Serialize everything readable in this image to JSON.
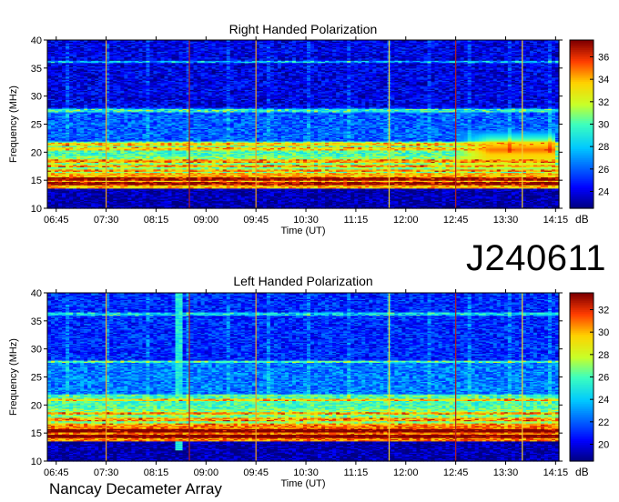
{
  "date_code": "J240611",
  "footer": "Nancay Decameter Array",
  "chart_data": [
    {
      "type": "heatmap",
      "title": "Right Handed Polarization",
      "xlabel": "Time (UT)",
      "ylabel": "Frequency (MHz)",
      "x_ticks": [
        "06:45",
        "07:30",
        "08:15",
        "09:00",
        "09:45",
        "10:30",
        "11:15",
        "12:00",
        "12:45",
        "13:30",
        "14:15"
      ],
      "y_ticks": [
        10,
        15,
        20,
        25,
        30,
        35,
        40
      ],
      "ylim": [
        10,
        40
      ],
      "colorbar": {
        "label": "dB",
        "ticks": [
          24,
          26,
          28,
          30,
          32,
          34,
          36
        ],
        "range": [
          22.5,
          37.5
        ]
      },
      "time_markers": [
        {
          "time": "07:30",
          "color": "#f0a020"
        },
        {
          "time": "08:45",
          "color": "#b02020"
        },
        {
          "time": "09:45",
          "color": "#f0a020"
        },
        {
          "time": "11:45",
          "color": "#f0d030"
        },
        {
          "time": "12:45",
          "color": "#b02020"
        },
        {
          "time": "13:45",
          "color": "#f0d030"
        }
      ],
      "bands": [
        {
          "freq": [
            10,
            13.6
          ],
          "level": 23
        },
        {
          "freq": [
            13.6,
            16.5
          ],
          "level": 34
        },
        {
          "freq": [
            16.5,
            19.5
          ],
          "level": 31
        },
        {
          "freq": [
            19.5,
            22
          ],
          "level": 30
        },
        {
          "freq": [
            22,
            28
          ],
          "level": 26
        },
        {
          "freq": [
            28,
            40
          ],
          "level": 24
        }
      ],
      "bright_lines": [
        14.5,
        15.3,
        16.8,
        17.6,
        18.5,
        20.7,
        21.5,
        27.5,
        36.2
      ],
      "hotspot": {
        "time_range": [
          "12:45",
          "14:15"
        ],
        "freq_range": [
          17,
          24
        ],
        "level": 35
      }
    },
    {
      "type": "heatmap",
      "title": "Left Handed Polarization",
      "xlabel": "Time (UT)",
      "ylabel": "Frequency (MHz)",
      "x_ticks": [
        "06:45",
        "07:30",
        "08:15",
        "09:00",
        "09:45",
        "10:30",
        "11:15",
        "12:00",
        "12:45",
        "13:30",
        "14:15"
      ],
      "y_ticks": [
        10,
        15,
        20,
        25,
        30,
        35,
        40
      ],
      "ylim": [
        10,
        40
      ],
      "colorbar": {
        "label": "dB",
        "ticks": [
          20,
          22,
          24,
          26,
          28,
          30,
          32
        ],
        "range": [
          18.5,
          33.5
        ]
      },
      "time_markers": [
        {
          "time": "07:30",
          "color": "#f0a020"
        },
        {
          "time": "08:45",
          "color": "#b02020"
        },
        {
          "time": "09:45",
          "color": "#f0a020"
        },
        {
          "time": "11:45",
          "color": "#f0d030"
        },
        {
          "time": "12:45",
          "color": "#b02020"
        },
        {
          "time": "13:45",
          "color": "#f0d030"
        }
      ],
      "bands": [
        {
          "freq": [
            10,
            13.6
          ],
          "level": 19
        },
        {
          "freq": [
            13.6,
            16.5
          ],
          "level": 31
        },
        {
          "freq": [
            16.5,
            19.5
          ],
          "level": 27
        },
        {
          "freq": [
            19.5,
            22
          ],
          "level": 26
        },
        {
          "freq": [
            22,
            28
          ],
          "level": 22.5
        },
        {
          "freq": [
            28,
            40
          ],
          "level": 21
        }
      ],
      "bright_lines": [
        14.5,
        15.5,
        16.6,
        17.5,
        18.6,
        21,
        27.8,
        36.3
      ],
      "bright_column": {
        "time": "08:36",
        "level": 25
      }
    }
  ]
}
